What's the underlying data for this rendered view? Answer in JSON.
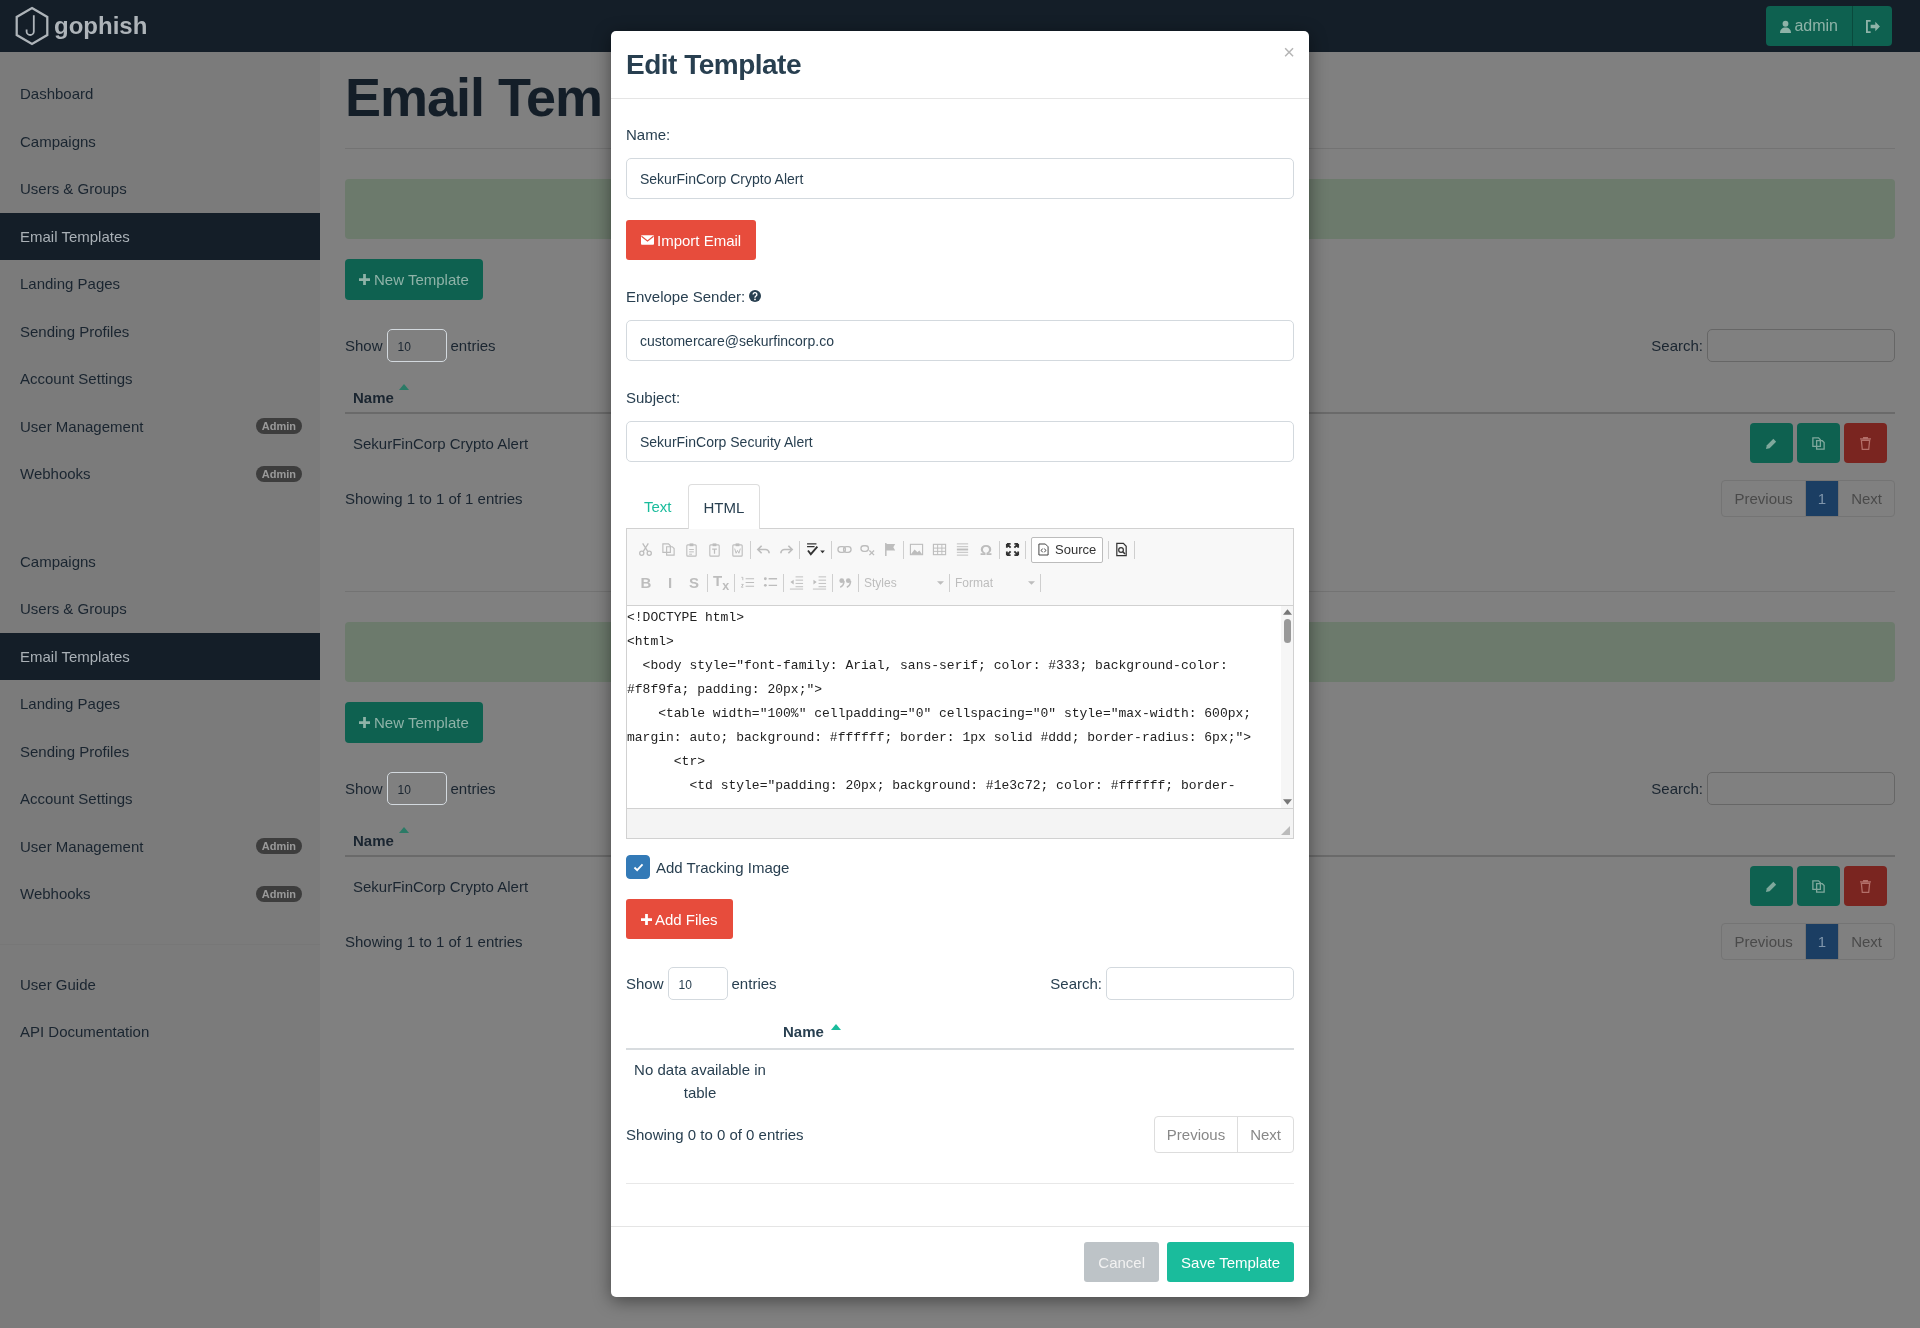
{
  "topbar": {
    "logo_text": "gophish",
    "user_button": "admin"
  },
  "sidebar": {
    "sections": [
      {
        "items": [
          {
            "label": "Dashboard",
            "selected": false
          },
          {
            "label": "Campaigns",
            "selected": false
          },
          {
            "label": "Users & Groups",
            "selected": false
          },
          {
            "label": "Email Templates",
            "selected": true
          },
          {
            "label": "Landing Pages",
            "selected": false
          },
          {
            "label": "Sending Profiles",
            "selected": false
          },
          {
            "label": "Account Settings",
            "selected": false
          },
          {
            "label": "User Management",
            "selected": false,
            "badge": "Admin"
          },
          {
            "label": "Webhooks",
            "selected": false,
            "badge": "Admin"
          }
        ]
      },
      {
        "items": [
          {
            "label": "Campaigns",
            "selected": false
          },
          {
            "label": "Users & Groups",
            "selected": false
          },
          {
            "label": "Email Templates",
            "selected": true
          },
          {
            "label": "Landing Pages",
            "selected": false
          },
          {
            "label": "Sending Profiles",
            "selected": false
          },
          {
            "label": "Account Settings",
            "selected": false
          },
          {
            "label": "User Management",
            "selected": false,
            "badge": "Admin"
          },
          {
            "label": "Webhooks",
            "selected": false,
            "badge": "Admin"
          }
        ]
      },
      {
        "items": [
          {
            "label": "User Guide",
            "selected": false
          },
          {
            "label": "API Documentation",
            "selected": false
          }
        ]
      }
    ]
  },
  "pages": [
    {
      "title": "Email Tem",
      "new_button": "New Template",
      "show_label": "Show",
      "page_length": "10",
      "entries_label": "entries",
      "search_label": "Search:",
      "column": "Name",
      "rows": [
        "SekurFinCorp Crypto Alert"
      ],
      "info": "Showing 1 to 1 of 1 entries",
      "pagination": [
        {
          "label": "Previous",
          "selected": false
        },
        {
          "label": "1",
          "selected": true
        },
        {
          "label": "Next",
          "selected": false
        }
      ]
    },
    {
      "new_button": "New Template",
      "show_label": "Show",
      "page_length": "10",
      "entries_label": "entries",
      "search_label": "Search:",
      "column": "Name",
      "rows": [
        "SekurFinCorp Crypto Alert"
      ],
      "info": "Showing 1 to 1 of 1 entries",
      "pagination": [
        {
          "label": "Previous",
          "selected": false
        },
        {
          "label": "1",
          "selected": true
        },
        {
          "label": "Next",
          "selected": false
        }
      ]
    }
  ],
  "modal": {
    "title": "Edit Template",
    "close": "×",
    "name_field": {
      "label": "Name:",
      "value": "SekurFinCorp Crypto Alert",
      "help": false
    },
    "import_button": "Import Email",
    "sender_field": {
      "label": "Envelope Sender:",
      "value": "customercare@sekurfincorp.co",
      "help": true
    },
    "subject_field": {
      "label": "Subject:",
      "value": "SekurFinCorp Security Alert",
      "help": false
    },
    "editor": {
      "tabs": [
        {
          "label": "Text",
          "selected": false
        },
        {
          "label": "HTML",
          "selected": true
        }
      ],
      "toolbar": [
        [
          [
            {
              "kind": "icon",
              "disabled": true
            },
            {
              "kind": "icon",
              "disabled": true
            },
            {
              "kind": "icon",
              "disabled": true
            },
            {
              "kind": "icon",
              "disabled": true
            },
            {
              "kind": "icon",
              "disabled": true
            }
          ],
          [
            {
              "kind": "icon",
              "disabled": true
            },
            {
              "kind": "icon",
              "disabled": true
            }
          ],
          [
            {
              "kind": "icon",
              "disabled": false
            }
          ],
          [
            {
              "kind": "icon",
              "disabled": true
            },
            {
              "kind": "icon",
              "disabled": true
            },
            {
              "kind": "icon",
              "disabled": true
            }
          ],
          [
            {
              "kind": "icon",
              "disabled": true
            },
            {
              "kind": "icon",
              "disabled": true
            },
            {
              "kind": "icon",
              "disabled": true
            },
            {
              "kind": "glyph",
              "label": "Ω",
              "disabled": true
            }
          ],
          [
            {
              "kind": "icon",
              "disabled": false
            }
          ],
          [
            {
              "kind": "source",
              "label": "Source",
              "disabled": false
            }
          ],
          [
            {
              "kind": "icon",
              "disabled": false
            }
          ]
        ],
        [
          [
            {
              "kind": "glyph",
              "label": "B",
              "disabled": true
            },
            {
              "kind": "glyph",
              "label": "I",
              "disabled": true
            },
            {
              "kind": "glyph",
              "label": "S",
              "disabled": true
            }
          ],
          [
            {
              "kind": "glyph",
              "label": "T$_{x}$",
              "disabled": true
            }
          ],
          [
            {
              "kind": "icon",
              "disabled": true
            },
            {
              "kind": "icon",
              "disabled": true
            }
          ],
          [
            {
              "kind": "icon",
              "disabled": true
            },
            {
              "kind": "icon",
              "disabled": true
            }
          ],
          [
            {
              "kind": "icon",
              "disabled": true
            }
          ],
          [
            {
              "kind": "combo",
              "label": "Styles",
              "disabled": true
            }
          ],
          [
            {
              "kind": "combo",
              "label": "Format",
              "disabled": true
            }
          ]
        ]
      ],
      "code_lines": [
        "<!DOCTYPE html>",
        "<html>",
        "  <body style=\"font-family: Arial, sans-serif; color: #333; background-color: #f8f9fa; padding: 20px;\">",
        "    <table width=\"100%\" cellpadding=\"0\" cellspacing=\"0\" style=\"max-width: 600px; margin: auto; background: #ffffff; border: 1px solid #ddd; border-radius: 6px;\">",
        "      <tr>",
        "        <td style=\"padding: 20px; background: #1e3c72; color: #ffffff; border-"
      ]
    },
    "tracking": {
      "label": "Add Tracking Image",
      "checked": true
    },
    "add_files_button": "Add Files",
    "attachments": {
      "show_label": "Show",
      "page_length": "10",
      "entries_label": "entries",
      "search_label": "Search:",
      "column": "Name",
      "empty_text": "No data available in table",
      "info": "Showing 0 to 0 of 0 entries",
      "pagination": [
        "Previous",
        "Next"
      ]
    },
    "buttons": [
      {
        "kind": "cancel",
        "label": "Cancel"
      },
      {
        "kind": "primary",
        "label": "Save Template"
      }
    ]
  }
}
